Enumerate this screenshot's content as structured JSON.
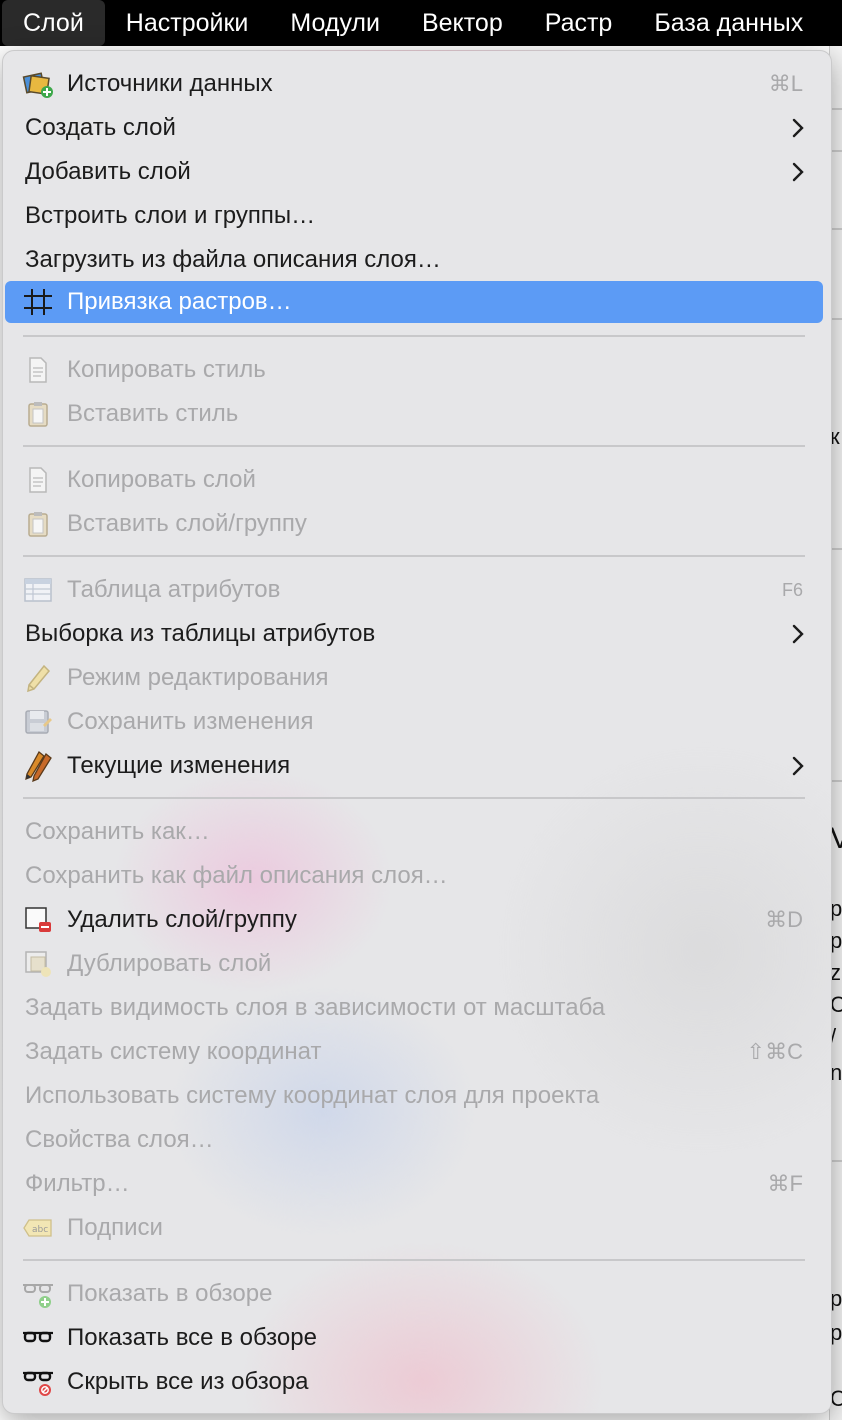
{
  "menubar": {
    "items": [
      "Слой",
      "Настройки",
      "Модули",
      "Вектор",
      "Растр",
      "База данных"
    ]
  },
  "menu": {
    "items": [
      {
        "label": "Источники данных",
        "shortcut": "⌘L",
        "icon": "data-source-icon"
      },
      {
        "label": "Создать слой",
        "submenu": true
      },
      {
        "label": "Добавить слой",
        "submenu": true
      },
      {
        "label": "Встроить слои и группы…"
      },
      {
        "label": "Загрузить из файла описания слоя…"
      },
      {
        "label": "Привязка растров…",
        "icon": "georeferencer-grid-icon",
        "highlighted": true
      },
      {
        "label": "Копировать стиль",
        "icon": "copy-style-icon",
        "disabled": true
      },
      {
        "label": "Вставить стиль",
        "icon": "paste-style-icon",
        "disabled": true
      },
      {
        "label": "Копировать слой",
        "icon": "copy-layer-icon",
        "disabled": true
      },
      {
        "label": "Вставить слой/группу",
        "icon": "paste-layer-icon",
        "disabled": true
      },
      {
        "label": "Таблица атрибутов",
        "shortcut": "F6",
        "icon": "attribute-table-icon",
        "disabled": true
      },
      {
        "label": "Выборка из таблицы атрибутов",
        "submenu": true
      },
      {
        "label": "Режим редактирования",
        "icon": "pencil-icon",
        "disabled": true
      },
      {
        "label": "Сохранить изменения",
        "icon": "save-edits-icon",
        "disabled": true
      },
      {
        "label": "Текущие изменения",
        "icon": "pencils-icon",
        "submenu": true
      },
      {
        "label": "Сохранить как…",
        "disabled": true
      },
      {
        "label": "Сохранить как файл описания слоя…",
        "disabled": true
      },
      {
        "label": "Удалить слой/группу",
        "shortcut": "⌘D",
        "icon": "remove-layer-icon"
      },
      {
        "label": "Дублировать слой",
        "icon": "duplicate-layer-icon",
        "disabled": true
      },
      {
        "label": "Задать видимость слоя в зависимости от масштаба",
        "disabled": true
      },
      {
        "label": "Задать систему координат",
        "shortcut": "⇧⌘C",
        "disabled": true
      },
      {
        "label": "Использовать систему координат слоя для проекта",
        "disabled": true
      },
      {
        "label": "Свойства слоя…",
        "disabled": true
      },
      {
        "label": "Фильтр…",
        "shortcut": "⌘F",
        "disabled": true
      },
      {
        "label": "Подписи",
        "icon": "labels-icon",
        "disabled": true
      },
      {
        "label": "Показать в обзоре",
        "icon": "overview-add-icon",
        "disabled": true
      },
      {
        "label": "Показать все в обзоре",
        "icon": "overview-all-icon"
      },
      {
        "label": "Скрыть все из обзора",
        "icon": "overview-hide-icon"
      }
    ]
  },
  "background_fragments": [
    "к",
    "V",
    "р",
    "р",
    "z",
    "C",
    "/",
    "n",
    "р",
    "р",
    "C"
  ]
}
